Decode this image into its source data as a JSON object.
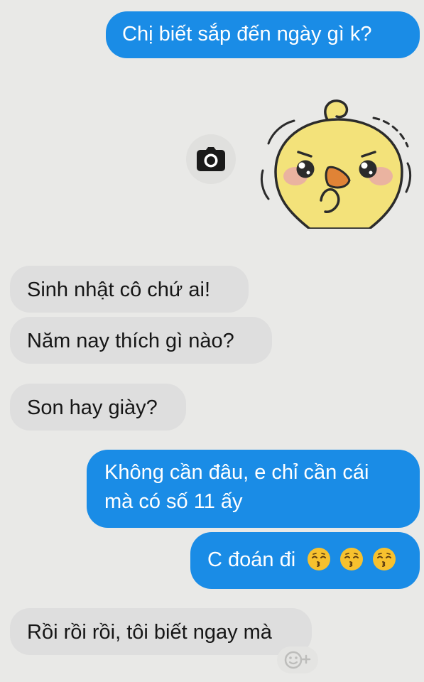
{
  "conversation": {
    "messages": [
      {
        "side": "outgoing",
        "text": "Chị biết sắp đến ngày gì k?"
      },
      {
        "side": "incoming",
        "text": "Sinh nhật cô chứ ai!"
      },
      {
        "side": "incoming",
        "text": "Năm nay thích gì nào?"
      },
      {
        "side": "incoming",
        "text": "Son hay giày?"
      },
      {
        "side": "outgoing",
        "lines": [
          "Không cần đâu, e chỉ cần cái",
          "mà có số 11 ấy"
        ]
      },
      {
        "side": "outgoing",
        "text": "C đoán đi",
        "emoji_count": 3,
        "emoji_name": "kissing-face-with-closed-eyes"
      },
      {
        "side": "incoming",
        "text": "Rồi rồi rồi, tôi biết ngay mà"
      }
    ]
  },
  "sticker": {
    "name": "yellow-chick-shy-sticker",
    "body_color": "#f3e27a"
  },
  "icons": {
    "camera": "camera-icon",
    "add_reaction": "add-reaction-icon"
  },
  "colors": {
    "background": "#e9e9e7",
    "outgoing_bubble": "#1a8ce6",
    "incoming_bubble": "#dedede",
    "incoming_text": "#161616",
    "emoji": "#f7c12e"
  }
}
